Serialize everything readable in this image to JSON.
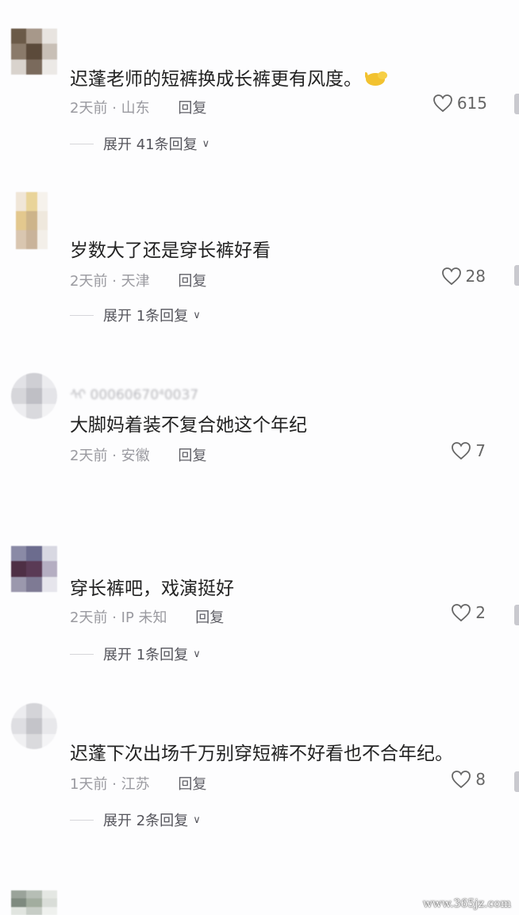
{
  "comments": [
    {
      "text": "迟蓬老师的短裤换成长裤更有风度。",
      "emoji": "hand-icon",
      "time": "2天前",
      "location": "山东",
      "reply_label": "回复",
      "likes": "615",
      "expand_label": "展开 41条回复"
    },
    {
      "text": "岁数大了还是穿长裤好看",
      "time": "2天前",
      "location": "天津",
      "reply_label": "回复",
      "likes": "28",
      "expand_label": "展开 1条回复"
    },
    {
      "username": "ᠰᠢ 00060670⁴0037",
      "text": "大脚妈着装不复合她这个年纪",
      "time": "2天前",
      "location": "安徽",
      "reply_label": "回复",
      "likes": "7"
    },
    {
      "text": "穿长裤吧，戏演挺好",
      "time": "2天前",
      "location": "IP 未知",
      "reply_label": "回复",
      "likes": "2",
      "expand_label": "展开 1条回复"
    },
    {
      "text": "迟蓬下次出场千万别穿短裤不好看也不合年纪。",
      "time": "1天前",
      "location": "江苏",
      "reply_label": "回复",
      "likes": "8",
      "expand_label": "展开 2条回复"
    }
  ],
  "meta_separator": "·",
  "expand_icon": "chevron-down-icon",
  "like_icon": "heart-outline-icon",
  "watermark": "www.365jz.com",
  "colors": {
    "text": "#222222",
    "meta": "#9a9aa0",
    "reply": "#5f5f66",
    "background": "#fdfdfe"
  }
}
